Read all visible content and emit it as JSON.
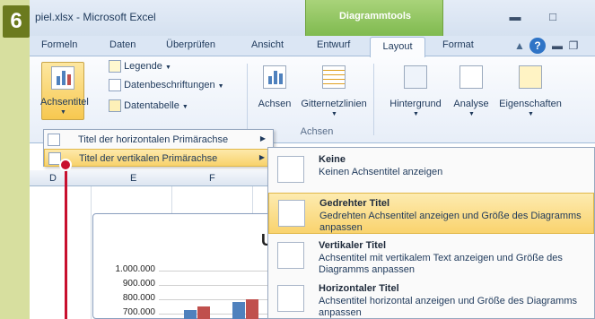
{
  "step_number": "6",
  "window": {
    "title": "piel.xlsx - Microsoft Excel",
    "context_tab": "Diagrammtools"
  },
  "tabs": [
    "Formeln",
    "Daten",
    "Überprüfen",
    "Ansicht",
    "Entwurf",
    "Layout",
    "Format"
  ],
  "ribbon": {
    "achsentitel": "Achsentitel",
    "legende": "Legende",
    "datenbeschriftungen": "Datenbeschriftungen",
    "datentabelle": "Datentabelle",
    "achsen": "Achsen",
    "gitternetzlinien": "Gitternetzlinien",
    "group_achsen": "Achsen",
    "hintergrund": "Hintergrund",
    "analyse": "Analyse",
    "eigenschaften": "Eigenschaften"
  },
  "columns": [
    "D",
    "E",
    "F"
  ],
  "menu1": [
    {
      "label": "Titel der horizontalen Primärachse"
    },
    {
      "label": "Titel der vertikalen Primärachse"
    }
  ],
  "menu2": [
    {
      "title": "Keine",
      "desc": "Keinen Achsentitel anzeigen"
    },
    {
      "title": "Gedrehter Titel",
      "desc": "Gedrehten Achsentitel anzeigen und Größe des Diagramms anpassen"
    },
    {
      "title": "Vertikaler Titel",
      "desc": "Achsentitel mit vertikalem Text anzeigen und Größe des Diagramms anpassen"
    },
    {
      "title": "Horizontaler Titel",
      "desc": "Achsentitel horizontal anzeigen und Größe des Diagramms anpassen"
    }
  ],
  "chart_data": {
    "type": "bar",
    "y_ticks": [
      "1.000.000",
      "900.000",
      "800.000",
      "700.000"
    ],
    "title_partial": "U",
    "series_colors": [
      "#4f81bd",
      "#c0504d"
    ]
  },
  "colors": {
    "context_green": "#7fba4f",
    "highlight": "#f8d26b",
    "pointer": "#c8102e",
    "badge": "#6b7a1e"
  }
}
